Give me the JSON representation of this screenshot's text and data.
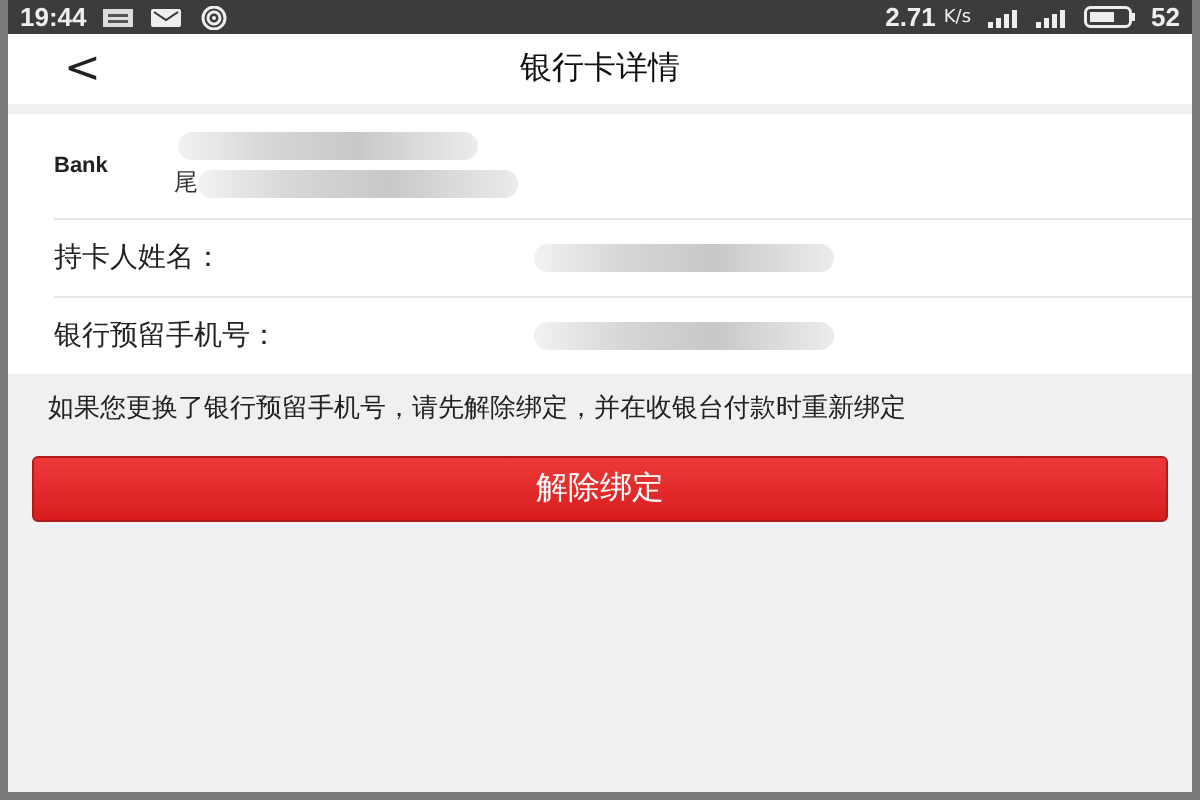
{
  "status_bar": {
    "time": "19:44",
    "speed": "2.71",
    "speed_unit": "K/s",
    "battery": "52"
  },
  "header": {
    "back": "<",
    "title": "银行卡详情"
  },
  "card": {
    "logo": "Bank",
    "tail_label": "尾"
  },
  "fields": [
    {
      "label": "持卡人姓名："
    },
    {
      "label": "银行预留手机号："
    }
  ],
  "notice": "如果您更换了银行预留手机号，请先解除绑定，并在收银台付款时重新绑定",
  "button": "解除绑定"
}
